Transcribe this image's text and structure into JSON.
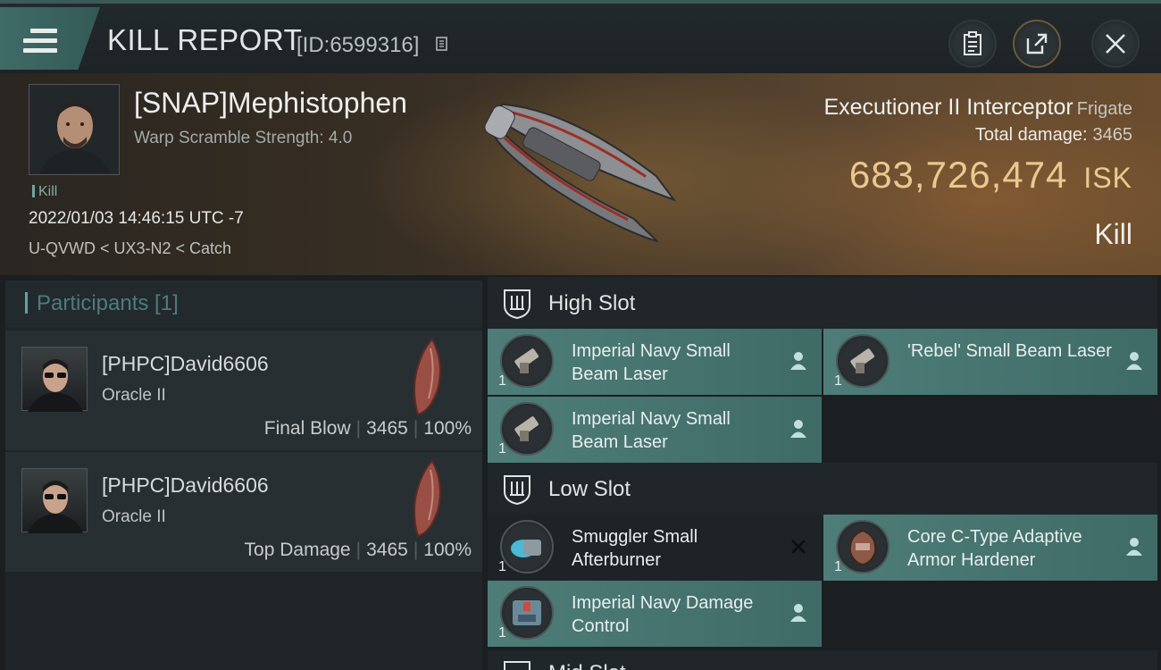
{
  "header": {
    "title": "KILL REPORT",
    "report_id": "[ID:6599316]"
  },
  "victim": {
    "name": "[SNAP]Mephistophen",
    "scramble": "Warp Scramble Strength: 4.0",
    "kill_tag": "Kill",
    "datetime": "2022/01/03 14:46:15 UTC -7",
    "location": "U-QVWD < UX3-N2 < Catch"
  },
  "ship": {
    "name": "Executioner II Interceptor",
    "class": "Frigate",
    "total_damage_label": "Total damage:",
    "total_damage": "3465",
    "isk_value": "683,726,474",
    "isk_unit": "ISK",
    "kill_type": "Kill"
  },
  "participants": {
    "title": "Participants [1]",
    "rows": [
      {
        "name": "[PHPC]David6606",
        "ship": "Oracle II",
        "label": "Final Blow",
        "damage": "3465",
        "percent": "100%"
      },
      {
        "name": "[PHPC]David6606",
        "ship": "Oracle II",
        "label": "Top Damage",
        "damage": "3465",
        "percent": "100%"
      }
    ]
  },
  "slots": {
    "high": {
      "label": "High Slot",
      "modules": [
        {
          "name": "Imperial Navy Small Beam Laser",
          "qty": "1",
          "icon": "beam-laser-icon"
        },
        {
          "name": "'Rebel' Small Beam Laser",
          "qty": "1",
          "icon": "beam-laser-icon"
        },
        {
          "name": "Imperial Navy Small Beam Laser",
          "qty": "1",
          "icon": "beam-laser-icon"
        }
      ]
    },
    "low": {
      "label": "Low Slot",
      "modules": [
        {
          "name": "Smuggler Small Afterburner",
          "qty": "1",
          "icon": "afterburner-icon",
          "state": "destroyed"
        },
        {
          "name": "Core C-Type Adaptive Armor Hardener",
          "qty": "1",
          "icon": "armor-hardener-icon",
          "state": "dropped"
        },
        {
          "name": "Imperial Navy Damage Control",
          "qty": "1",
          "icon": "damage-control-icon",
          "state": "dropped"
        }
      ]
    },
    "mid": {
      "label": "Mid Slot"
    }
  },
  "colors": {
    "accent": "#4e7d78",
    "isk": "#e9c98e",
    "background": "#1b1f22"
  }
}
